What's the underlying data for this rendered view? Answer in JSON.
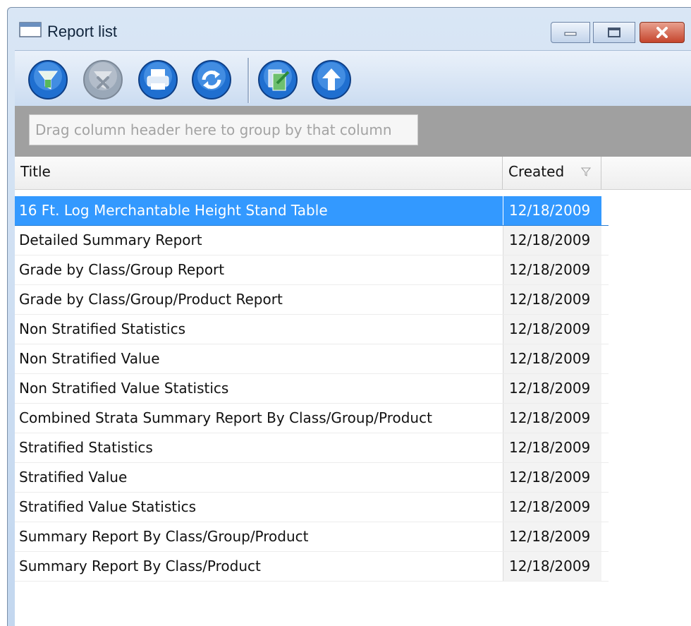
{
  "window": {
    "title": "Report list"
  },
  "toolbar": {
    "buttons": [
      {
        "icon": "filter-icon",
        "enabled": true
      },
      {
        "icon": "clear-filter-icon",
        "enabled": false
      },
      {
        "icon": "print-icon",
        "enabled": true
      },
      {
        "icon": "refresh-icon",
        "enabled": true
      },
      {
        "icon": "export-icon",
        "enabled": true
      },
      {
        "icon": "up-arrow-icon",
        "enabled": true
      }
    ]
  },
  "grouping": {
    "hint": "Drag column header here to group by that column"
  },
  "grid": {
    "columns": {
      "title": "Title",
      "created": "Created"
    },
    "selected_index": 0,
    "rows": [
      {
        "title": "16 Ft. Log Merchantable Height Stand Table",
        "created": "12/18/2009"
      },
      {
        "title": "Detailed Summary Report",
        "created": "12/18/2009"
      },
      {
        "title": "Grade by Class/Group Report",
        "created": "12/18/2009"
      },
      {
        "title": "Grade by Class/Group/Product Report",
        "created": "12/18/2009"
      },
      {
        "title": "Non Stratified Statistics",
        "created": "12/18/2009"
      },
      {
        "title": "Non Stratified Value",
        "created": "12/18/2009"
      },
      {
        "title": "Non Stratified Value Statistics",
        "created": "12/18/2009"
      },
      {
        "title": "Combined Strata Summary Report By Class/Group/Product",
        "created": "12/18/2009"
      },
      {
        "title": "Stratified Statistics",
        "created": "12/18/2009"
      },
      {
        "title": "Stratified Value",
        "created": "12/18/2009"
      },
      {
        "title": "Stratified Value Statistics",
        "created": "12/18/2009"
      },
      {
        "title": "Summary Report By Class/Group/Product",
        "created": "12/18/2009"
      },
      {
        "title": "Summary Report By Class/Product",
        "created": "12/18/2009"
      }
    ]
  },
  "colors": {
    "selection": "#3399ff",
    "toolbar_button": "#1f6fd0",
    "close_button": "#c5452d"
  }
}
